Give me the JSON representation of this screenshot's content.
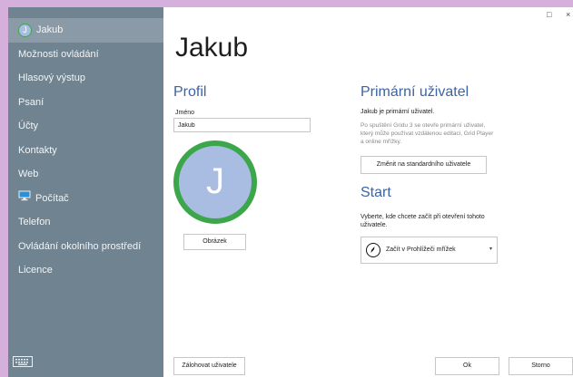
{
  "sidebar": {
    "items": [
      {
        "label": "Jakub",
        "active": true
      },
      {
        "label": "Možnosti ovládání"
      },
      {
        "label": "Hlasový výstup"
      },
      {
        "label": "Psaní"
      },
      {
        "label": "Účty"
      },
      {
        "label": "Kontakty"
      },
      {
        "label": "Web"
      },
      {
        "label": "Počítač"
      },
      {
        "label": "Telefon"
      },
      {
        "label": "Ovládání okolního prostředí"
      },
      {
        "label": "Licence"
      }
    ],
    "avatar_letter": "J"
  },
  "window": {
    "maximize_glyph": "□",
    "close_glyph": "×"
  },
  "page_title": "Jakub",
  "profile": {
    "title": "Profil",
    "name_label": "Jméno",
    "name_value": "Jakub",
    "avatar_letter": "J",
    "picture_button": "Obrázek"
  },
  "primary_user": {
    "title": "Primární uživatel",
    "status": "Jakub je primární uživatel.",
    "description_lines": [
      "Po spuštění Gridu 3 se otevře primární uživatel,",
      "který může používat vzdálenou editaci, Grid Player",
      "a online mřížky."
    ],
    "change_button": "Změnit na standardního uživatele"
  },
  "start": {
    "title": "Start",
    "instruction_lines": [
      "Vyberte, kde chcete začít při otevření tohoto",
      "uživatele."
    ],
    "selected_option": "Začít v Prohlížeči mřížek"
  },
  "footer": {
    "backup_button": "Zálohovat uživatele",
    "ok_button": "Ok",
    "cancel_button": "Storno"
  },
  "colors": {
    "sidebar_bg": "#6f8390",
    "accent": "#3a63a8",
    "avatar_bg": "#a9bde2",
    "avatar_ring": "#3ca64a",
    "desktop_bg": "#d6b0dc"
  }
}
